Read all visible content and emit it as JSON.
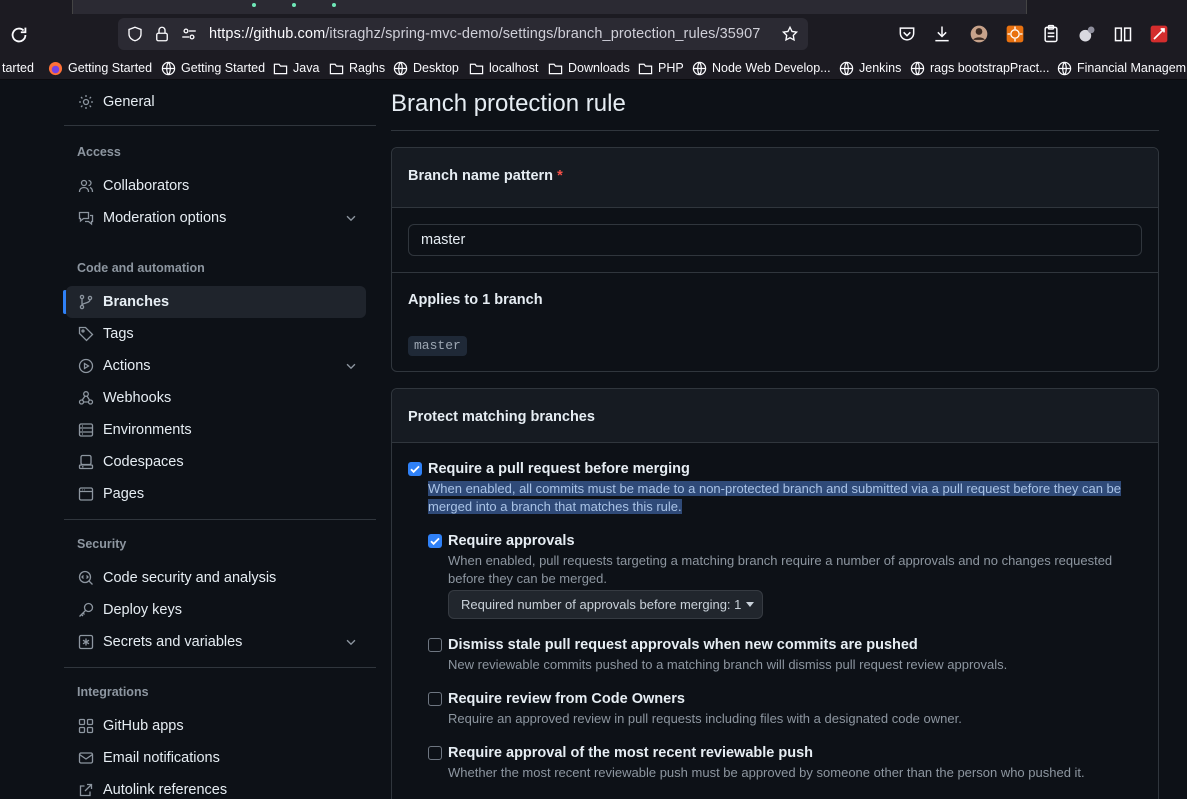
{
  "browser": {
    "url_host": "https://github.com",
    "url_path": "/itsraghz/spring-mvc-demo/settings/branch_protection_rules/35907",
    "bookmarks": [
      "tarted",
      "Getting Started",
      "Getting Started",
      "Java",
      "Raghs",
      "Desktop",
      "localhost",
      "Downloads",
      "PHP",
      "Node Web Develop...",
      "Jenkins",
      "rags bootstrapPract...",
      "Financial Managem..."
    ]
  },
  "sidebar": {
    "general": "General",
    "access_heading": "Access",
    "collaborators": "Collaborators",
    "moderation": "Moderation options",
    "code_heading": "Code and automation",
    "branches": "Branches",
    "tags": "Tags",
    "actions": "Actions",
    "webhooks": "Webhooks",
    "environments": "Environments",
    "codespaces": "Codespaces",
    "pages": "Pages",
    "security_heading": "Security",
    "code_security": "Code security and analysis",
    "deploy_keys": "Deploy keys",
    "secrets": "Secrets and variables",
    "integrations_heading": "Integrations",
    "github_apps": "GitHub apps",
    "email_notifications": "Email notifications",
    "autolink": "Autolink references"
  },
  "main": {
    "title": "Branch protection rule",
    "pattern_label": "Branch name pattern",
    "required_mark": "*",
    "pattern_value": "master",
    "applies_label": "Applies to 1 branch",
    "branch_chip": "master",
    "protect_heading": "Protect matching branches",
    "options": {
      "require_pr": {
        "label": "Require a pull request before merging",
        "desc": "When enabled, all commits must be made to a non-protected branch and submitted via a pull request before they can be merged into a branch that matches this rule.",
        "checked": true
      },
      "require_approvals": {
        "label": "Require approvals",
        "desc": "When enabled, pull requests targeting a matching branch require a number of approvals and no changes requested before they can be merged.",
        "checked": true
      },
      "approvals_dropdown": "Required number of approvals before merging: 1",
      "dismiss_stale": {
        "label": "Dismiss stale pull request approvals when new commits are pushed",
        "desc": "New reviewable commits pushed to a matching branch will dismiss pull request review approvals.",
        "checked": false
      },
      "code_owners": {
        "label": "Require review from Code Owners",
        "desc": "Require an approved review in pull requests including files with a designated code owner.",
        "checked": false
      },
      "recent_push": {
        "label": "Require approval of the most recent reviewable push",
        "desc": "Whether the most recent reviewable push must be approved by someone other than the person who pushed it.",
        "checked": false
      }
    }
  },
  "colors": {
    "accent": "#2f81f7",
    "required": "#f85149",
    "background": "#0d1117"
  }
}
